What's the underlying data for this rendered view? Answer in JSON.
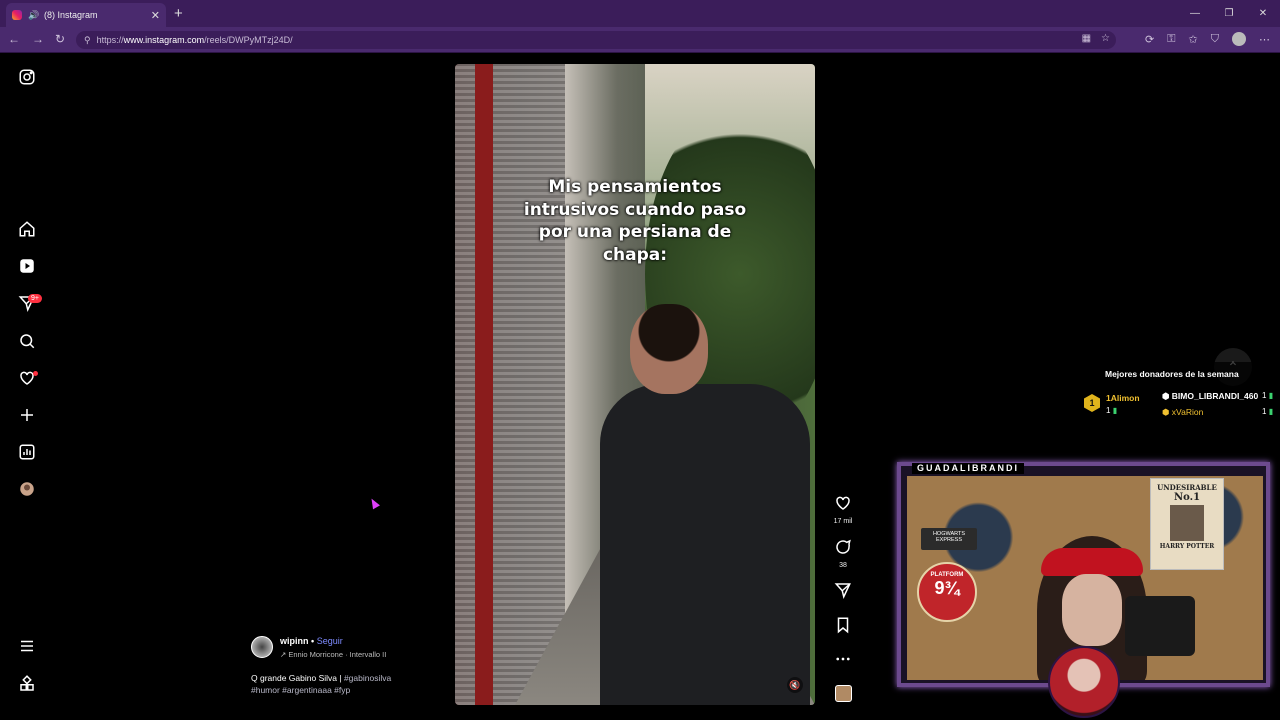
{
  "browser": {
    "tab_title": "(8) Instagram",
    "url_prefix": "https://",
    "url_host": "www.instagram.com",
    "url_path": "/reels/DWPyMTzj24D/"
  },
  "sidebar": {
    "notifications_badge": "9+"
  },
  "reel": {
    "caption": "Mis pensamientos\nintrusivos cuando paso\npor una persiana de\nchapa:",
    "likes": "17 mil",
    "comments": "38"
  },
  "post": {
    "username": "wipinn",
    "separator": "•",
    "follow_label": "Seguir",
    "audio": "Ennio Morricone · Intervallo II",
    "description": "Q grande Gabino Silva |",
    "description_tag1": "#gabinosilva",
    "hashtags": "#humor #argentinaaa #fyp"
  },
  "overlay": {
    "donors_title": "Mejores donadores de la semana",
    "medal_rank": "1",
    "donor1": "1Alimon",
    "donor1_count": "1",
    "donor2": "BIMO_LIBRANDI_460",
    "donor2_count": "1",
    "donor3": "xVaRion",
    "donor3_count": "1",
    "cam_label": "GUADALIBRANDI",
    "poster_top": "UNDESIRABLE",
    "poster_num": "No.1",
    "poster_name": "HARRY POTTER",
    "hogwarts_sign": "HOGWARTS EXPRESS",
    "platform_top": "PLATFORM",
    "platform_num": "9¾"
  },
  "colors": {
    "browser_frame": "#3b1d5a",
    "follow_link": "#7e8bff",
    "notification_red": "#ff3040",
    "donor_gold": "#f0c030"
  }
}
